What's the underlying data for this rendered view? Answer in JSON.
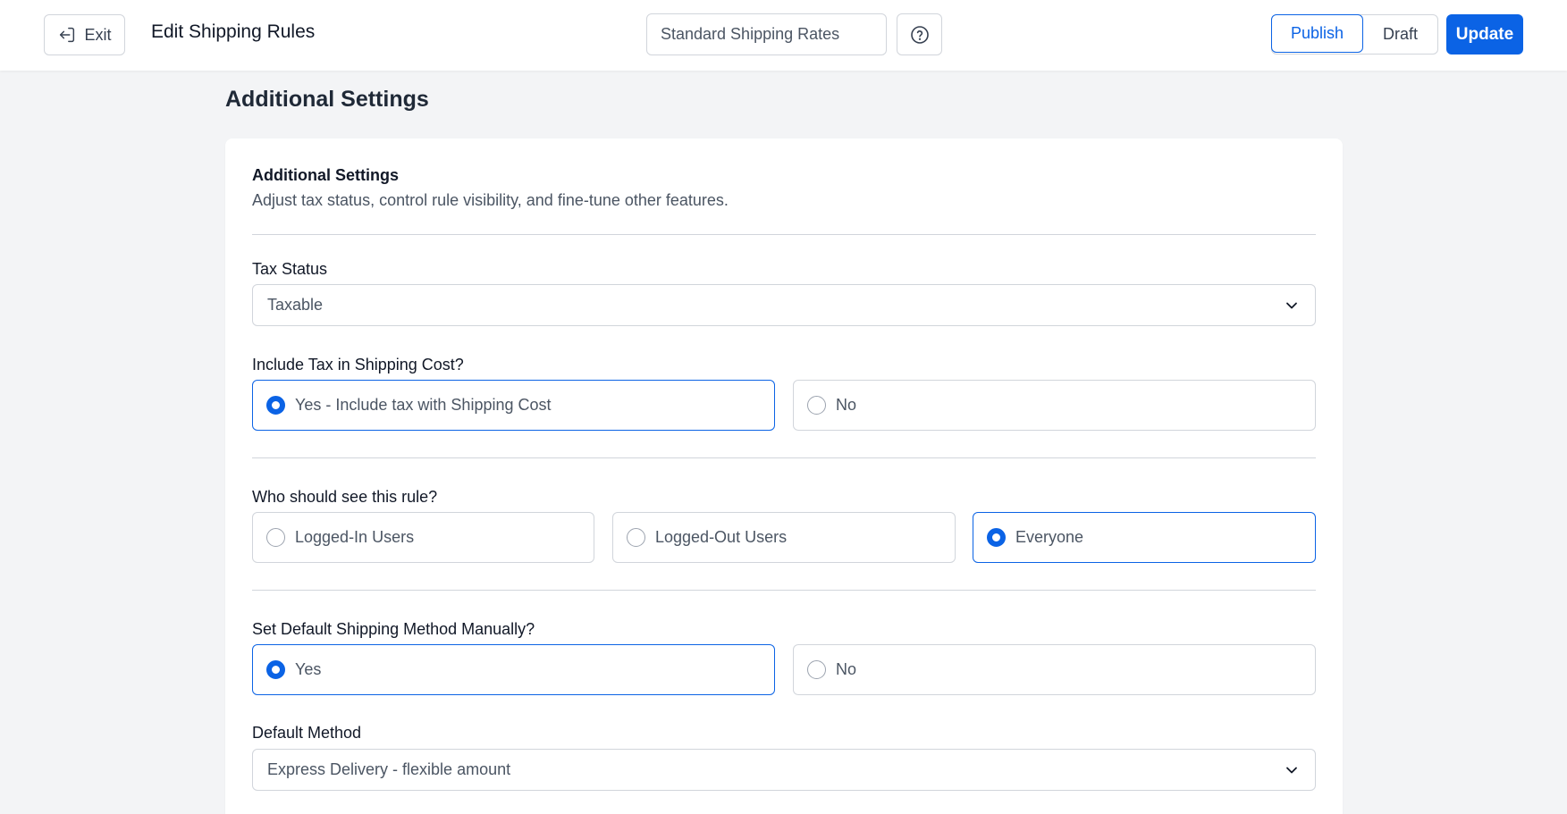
{
  "header": {
    "exit_label": "Exit",
    "title": "Edit Shipping Rules",
    "rule_name_value": "Standard Shipping Rates",
    "status_options": [
      "Publish",
      "Draft"
    ],
    "status_selected": "Publish",
    "update_label": "Update"
  },
  "page": {
    "section_heading": "Additional Settings"
  },
  "card": {
    "title": "Additional Settings",
    "description": "Adjust tax status, control rule visibility, and fine-tune other features."
  },
  "tax_status": {
    "label": "Tax Status",
    "selected": "Taxable"
  },
  "include_tax": {
    "label": "Include Tax in Shipping Cost?",
    "options": [
      "Yes - Include tax with Shipping Cost",
      "No"
    ],
    "selected_index": 0
  },
  "visibility": {
    "label": "Who should see this rule?",
    "options": [
      "Logged-In Users",
      "Logged-Out Users",
      "Everyone"
    ],
    "selected_index": 2
  },
  "default_manual": {
    "label": "Set Default Shipping Method Manually?",
    "options": [
      "Yes",
      "No"
    ],
    "selected_index": 0
  },
  "default_method": {
    "label": "Default Method",
    "selected": "Express Delivery - flexible amount"
  },
  "colors": {
    "accent": "#0b63e5",
    "background": "#f3f4f6",
    "border": "#d1d5db"
  },
  "icons": {
    "exit": "exit-door-icon",
    "help": "question-circle-icon",
    "dropdown": "chevron-down-icon"
  }
}
